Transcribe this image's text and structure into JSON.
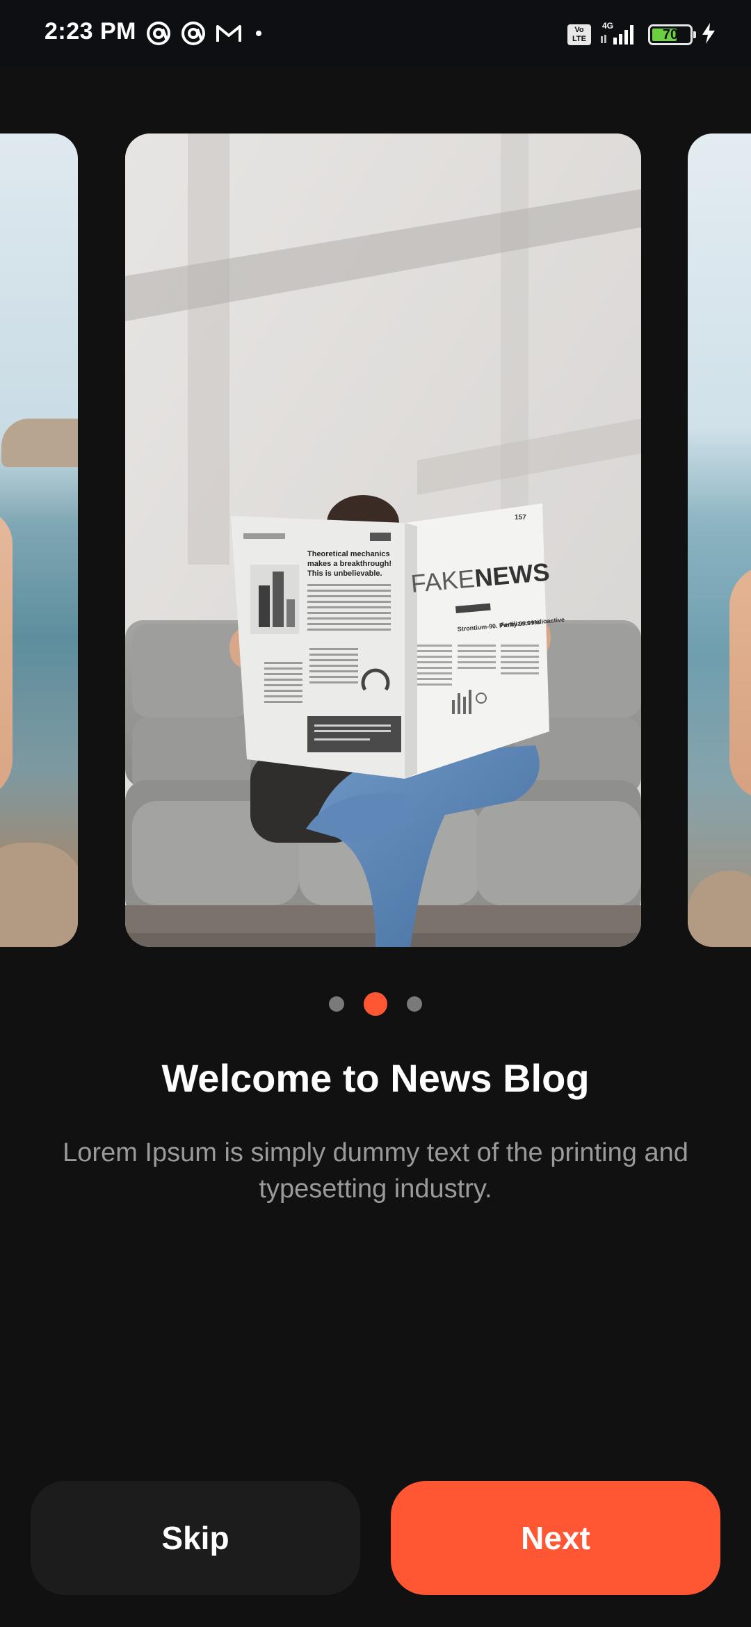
{
  "status_bar": {
    "time": "2:23 PM",
    "left_icons": [
      "at-sign-icon",
      "at-sign-icon",
      "gmail-icon",
      "notification-dot-icon"
    ],
    "volte": "Vo LTE",
    "network": "4G",
    "battery_level": "70",
    "battery_percent": 0.7,
    "charging_icon": "lightning-bolt-icon"
  },
  "carousel": {
    "current_index": 1,
    "total": 3,
    "main_image": {
      "newspaper_title_light": "FAKE",
      "newspaper_title_bold": "NEWS",
      "headline": "Theoretical mechanics makes a breakthrough! This is unbelievable.",
      "side_heading": "Strontium-90. Purity 99.99%",
      "side_heading_2": "Fertilizers radioactive",
      "page_number": "157"
    }
  },
  "onboarding": {
    "title": "Welcome to News Blog",
    "description": "Lorem Ipsum is simply dummy text of the printing and typesetting industry."
  },
  "buttons": {
    "skip": "Skip",
    "next": "Next"
  },
  "colors": {
    "accent": "#ff5733",
    "background": "#111111",
    "skip_button": "#1c1c1c",
    "inactive_dot": "#7a7a7a"
  }
}
